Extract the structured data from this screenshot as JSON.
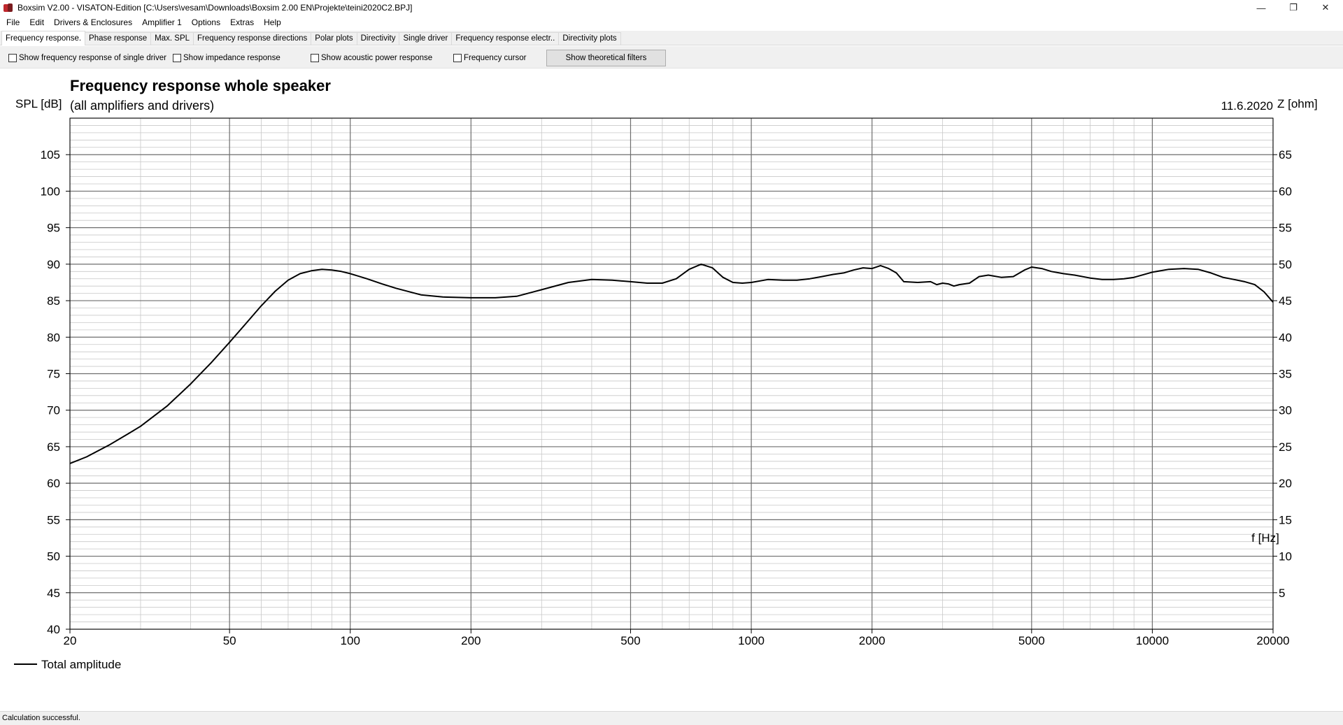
{
  "window": {
    "title": "Boxsim V2.00 - VISATON-Edition [C:\\Users\\vesam\\Downloads\\Boxsim 2.00 EN\\Projekte\\teini2020C2.BPJ]",
    "minimize_glyph": "—",
    "maximize_glyph": "❐",
    "close_glyph": "✕"
  },
  "menu": [
    "File",
    "Edit",
    "Drivers & Enclosures",
    "Amplifier 1",
    "Options",
    "Extras",
    "Help"
  ],
  "tabs": [
    {
      "label": "Frequency response.",
      "active": true
    },
    {
      "label": "Phase response",
      "active": false
    },
    {
      "label": "Max. SPL",
      "active": false
    },
    {
      "label": "Frequency response directions",
      "active": false
    },
    {
      "label": "Polar plots",
      "active": false
    },
    {
      "label": "Directivity",
      "active": false
    },
    {
      "label": "Single driver",
      "active": false
    },
    {
      "label": "Frequency response electr..",
      "active": false
    },
    {
      "label": "Directivity plots",
      "active": false
    }
  ],
  "options": {
    "single_driver": "Show frequency response of single driver",
    "impedance": "Show impedance response",
    "acoustic_power": "Show acoustic power response",
    "frequency_cursor": "Frequency cursor",
    "theoretical_filters_button": "Show theoretical filters",
    "checked": [
      false,
      false,
      false,
      false
    ]
  },
  "chart_data": {
    "type": "line",
    "title": "Frequency response whole speaker",
    "subtitle": "(all amplifiers and drivers)",
    "date": "11.6.2020",
    "ylabel": "SPL [dB]",
    "y2label": "Z [ohm]",
    "xlabel": "f [Hz]",
    "xscale": "log",
    "xlim": [
      20,
      20000
    ],
    "ylim": [
      40,
      110
    ],
    "y2lim": [
      0,
      70
    ],
    "x_ticks": [
      "20",
      "50",
      "100",
      "200",
      "500",
      "1000",
      "2000",
      "5000",
      "10000",
      "20000"
    ],
    "y_ticks": [
      "105",
      "100",
      "95",
      "90",
      "85",
      "80",
      "75",
      "70",
      "65",
      "60",
      "55",
      "50",
      "45",
      "40"
    ],
    "y2_ticks": [
      "65",
      "60",
      "55",
      "50",
      "45",
      "40",
      "35",
      "30",
      "25",
      "20",
      "15",
      "10",
      "5"
    ],
    "grid": true,
    "legend_position": "bottom-left",
    "series": [
      {
        "name": "Total amplitude",
        "color": "#000000",
        "x": [
          20,
          22,
          25,
          28,
          30,
          35,
          40,
          45,
          50,
          55,
          60,
          65,
          70,
          75,
          80,
          85,
          90,
          95,
          100,
          110,
          120,
          130,
          150,
          170,
          200,
          230,
          260,
          300,
          350,
          400,
          450,
          500,
          550,
          600,
          650,
          700,
          750,
          800,
          850,
          900,
          950,
          1000,
          1100,
          1200,
          1300,
          1400,
          1500,
          1600,
          1700,
          1800,
          1900,
          2000,
          2100,
          2200,
          2300,
          2400,
          2600,
          2800,
          2900,
          3000,
          3100,
          3200,
          3300,
          3500,
          3700,
          3900,
          4200,
          4500,
          4800,
          5000,
          5300,
          5600,
          6000,
          6400,
          7000,
          7500,
          8000,
          8500,
          9000,
          10000,
          11000,
          12000,
          13000,
          14000,
          15000,
          16000,
          17000,
          18000,
          19000,
          20000
        ],
        "y": [
          62.7,
          63.6,
          65.2,
          66.8,
          67.8,
          70.6,
          73.6,
          76.5,
          79.3,
          81.9,
          84.3,
          86.3,
          87.8,
          88.7,
          89.1,
          89.3,
          89.2,
          89.0,
          88.7,
          88.0,
          87.3,
          86.7,
          85.8,
          85.5,
          85.4,
          85.4,
          85.6,
          86.5,
          87.5,
          87.9,
          87.8,
          87.6,
          87.4,
          87.4,
          88.0,
          89.3,
          90.0,
          89.5,
          88.2,
          87.5,
          87.4,
          87.5,
          87.9,
          87.8,
          87.8,
          88.0,
          88.3,
          88.6,
          88.8,
          89.2,
          89.5,
          89.4,
          89.8,
          89.4,
          88.8,
          87.6,
          87.5,
          87.6,
          87.2,
          87.4,
          87.3,
          87.0,
          87.2,
          87.4,
          88.3,
          88.5,
          88.2,
          88.3,
          89.2,
          89.6,
          89.4,
          89.0,
          88.7,
          88.5,
          88.1,
          87.9,
          87.9,
          88.0,
          88.2,
          88.9,
          89.3,
          89.4,
          89.3,
          88.8,
          88.2,
          87.9,
          87.6,
          87.2,
          86.2,
          84.8
        ]
      }
    ]
  },
  "status": {
    "text": "Calculation successful."
  }
}
